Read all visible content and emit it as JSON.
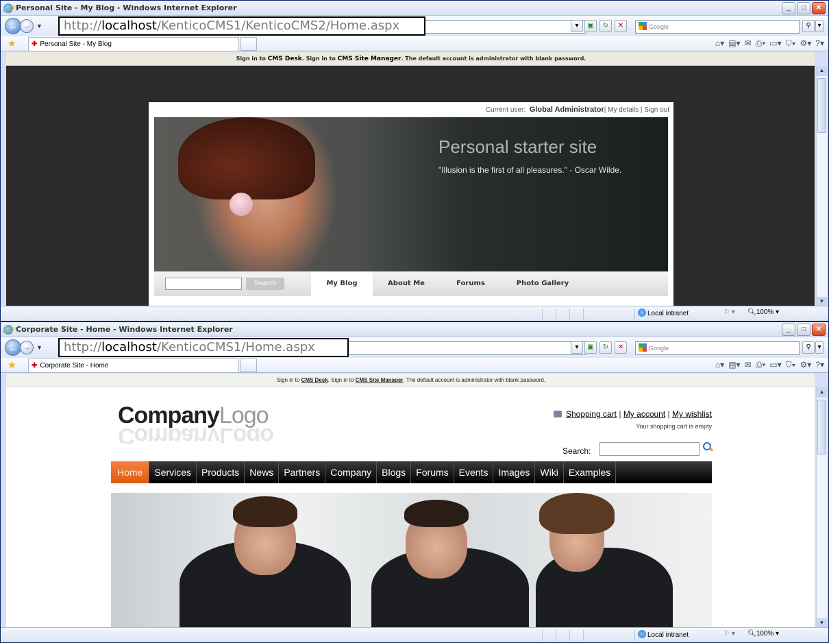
{
  "window1": {
    "title": "Personal Site - My Blog - Windows Internet Explorer",
    "url_prefix": "http://",
    "url_host": "localhost",
    "url_path": "/KenticoCMS1/KenticoCMS2/Home.aspx",
    "search_provider": "Google",
    "tab_label": "Personal Site - My Blog",
    "status_zone": "Local intranet",
    "status_zoom": "100%",
    "page": {
      "signbar": {
        "pre": "Sign in to ",
        "cms_desk": "CMS Desk",
        "mid": ". Sign in to ",
        "site_manager": "CMS Site Manager",
        "post": ". The default account is administrator with blank password."
      },
      "current_user_label": "Current user:",
      "current_user": "Global Administrator",
      "my_details": "My details",
      "sign_out": "Sign out",
      "hero_title": "Personal starter site",
      "hero_quote": "\"Illusion is the first of all pleasures.\" - Oscar Wilde.",
      "search_button": "Search",
      "menu": [
        "My Blog",
        "About Me",
        "Forums",
        "Photo Gallery"
      ]
    }
  },
  "window2": {
    "title": "Corporate Site - Home - Windows Internet Explorer",
    "url_prefix": "http://",
    "url_host": "localhost",
    "url_path": "/KenticoCMS1/Home.aspx",
    "search_provider": "Google",
    "tab_label": "Corporate Site - Home",
    "status_zone": "Local intranet",
    "status_zoom": "100%",
    "page": {
      "signbar": {
        "pre": "Sign in to ",
        "cms_desk": "CMS Desk",
        "mid": ". Sign in to ",
        "site_manager": "CMS Site Manager",
        "post": ". The default account is administrator with blank password."
      },
      "logo_part1": "Company",
      "logo_part2": "Logo",
      "shopping_cart": "Shopping cart",
      "my_account": "My account",
      "my_wishlist": "My wishlist",
      "sep": " | ",
      "cart_status": "Your shopping cart is empty",
      "search_label": "Search:",
      "menu": [
        "Home",
        "Services",
        "Products",
        "News",
        "Partners",
        "Company",
        "Blogs",
        "Forums",
        "Events",
        "Images",
        "Wiki",
        "Examples"
      ]
    }
  },
  "colors": {
    "menu_active": "#e25b12",
    "ie_frame": "#d6dff5"
  },
  "icons": {
    "back": "back-arrow-icon",
    "forward": "forward-arrow-icon",
    "refresh": "refresh-icon",
    "stop": "stop-icon",
    "favorites": "star-icon",
    "search": "magnifier-icon",
    "home": "home-icon",
    "globe": "globe-icon"
  }
}
